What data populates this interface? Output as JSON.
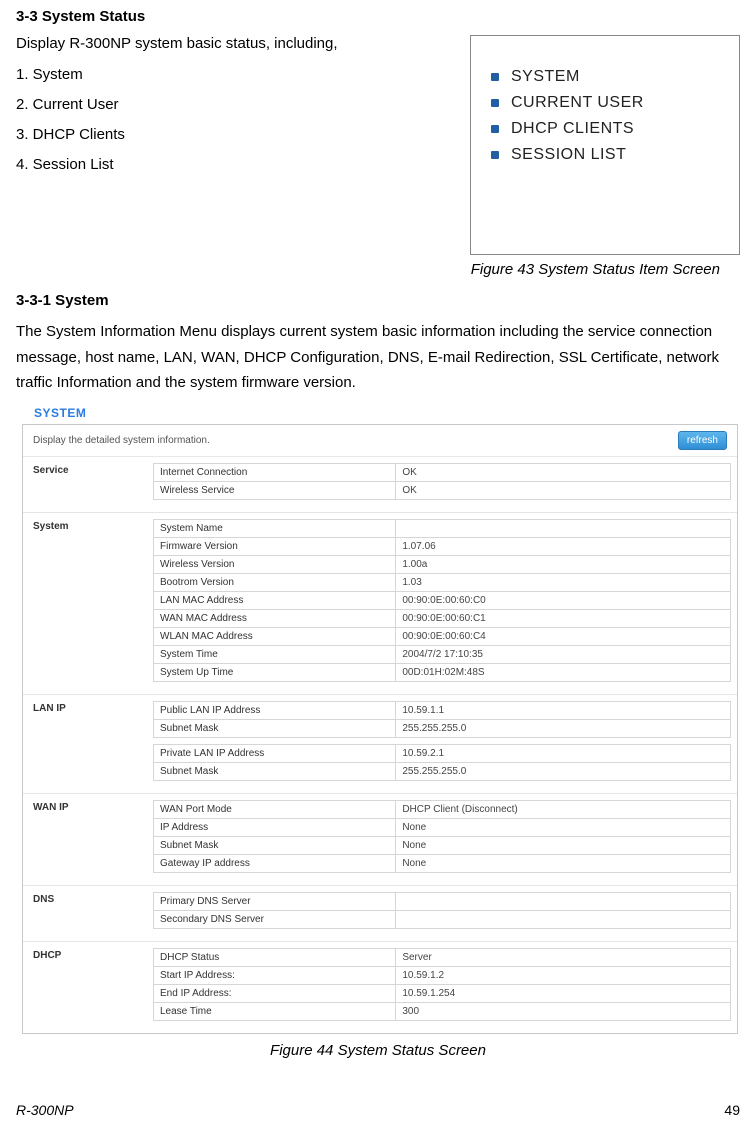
{
  "section_title_1": "3-3   System Status",
  "intro_text": "Display R-300NP system basic status, including,",
  "num_list": [
    "1.    System",
    "2.    Current User",
    "3.    DHCP Clients",
    "4.    Session List"
  ],
  "sidebar_items": [
    "SYSTEM",
    "CURRENT USER",
    "DHCP CLIENTS",
    "SESSION LIST"
  ],
  "fig43_caption": "Figure 43 System Status Item Screen",
  "section_title_2": "3-3-1  System",
  "body_para": "The System Information Menu displays current system basic information including the service connection message, host name, LAN, WAN, DHCP Configuration, DNS, E-mail Redirection, SSL Certificate, network traffic Information and the system firmware version.",
  "system_title": "SYSTEM",
  "desc_text": "Display the detailed system information.",
  "refresh_label": "refresh",
  "sections": {
    "service": {
      "label": "Service",
      "rows": [
        [
          "Internet Connection",
          "OK"
        ],
        [
          "Wireless Service",
          "OK"
        ]
      ]
    },
    "system": {
      "label": "System",
      "rows": [
        [
          "System Name",
          ""
        ],
        [
          "Firmware Version",
          "1.07.06"
        ],
        [
          "Wireless Version",
          "1.00a"
        ],
        [
          "Bootrom Version",
          "1.03"
        ],
        [
          "LAN MAC Address",
          "00:90:0E:00:60:C0"
        ],
        [
          "WAN MAC Address",
          "00:90:0E:00:60:C1"
        ],
        [
          "WLAN MAC Address",
          "00:90:0E:00:60:C4"
        ],
        [
          "System Time",
          "2004/7/2   17:10:35"
        ],
        [
          "System Up Time",
          "00D:01H:02M:48S"
        ]
      ]
    },
    "lanip": {
      "label": "LAN IP",
      "tables": [
        [
          [
            "Public LAN IP Address",
            "10.59.1.1"
          ],
          [
            "Subnet Mask",
            "255.255.255.0"
          ]
        ],
        [
          [
            "Private LAN IP Address",
            "10.59.2.1"
          ],
          [
            "Subnet Mask",
            "255.255.255.0"
          ]
        ]
      ]
    },
    "wanip": {
      "label": "WAN IP",
      "rows": [
        [
          "WAN Port Mode",
          "DHCP Client (Disconnect)"
        ],
        [
          "IP Address",
          "None"
        ],
        [
          "Subnet Mask",
          "None"
        ],
        [
          "Gateway IP address",
          "None"
        ]
      ]
    },
    "dns": {
      "label": "DNS",
      "rows": [
        [
          "Primary DNS Server",
          ""
        ],
        [
          "Secondary DNS Server",
          ""
        ]
      ]
    },
    "dhcp": {
      "label": "DHCP",
      "rows": [
        [
          "DHCP Status",
          "Server"
        ],
        [
          "Start IP Address:",
          "10.59.1.2"
        ],
        [
          "End IP Address:",
          "10.59.1.254"
        ],
        [
          "Lease Time",
          "300"
        ]
      ]
    }
  },
  "fig44_caption": "Figure 44 System Status Screen",
  "footer_left": "R-300NP",
  "footer_right": "49"
}
